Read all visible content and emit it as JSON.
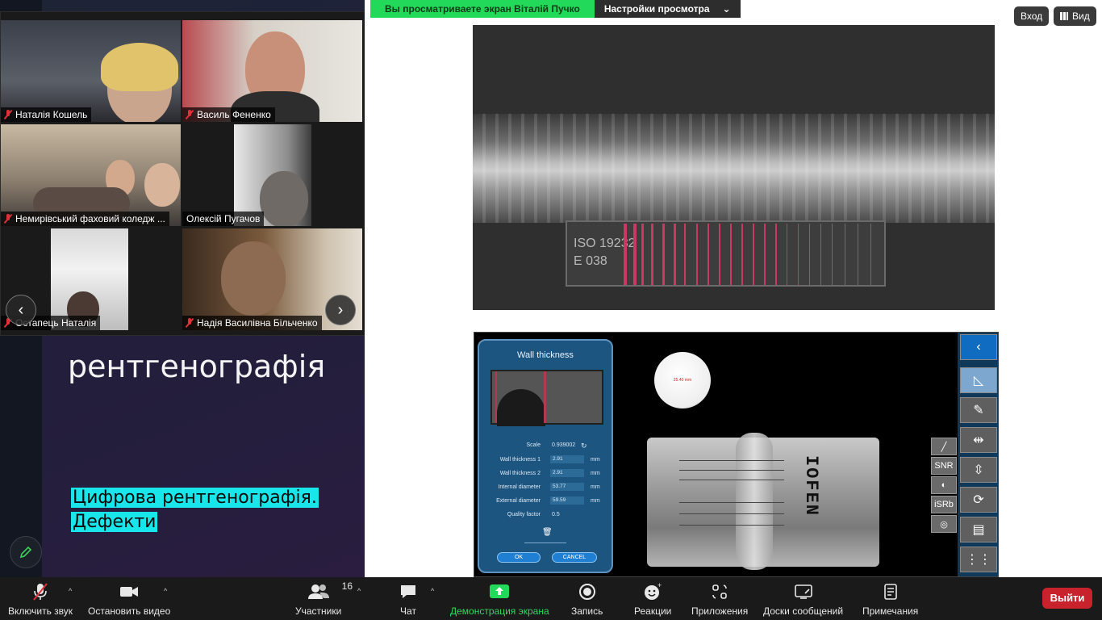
{
  "banner": {
    "sharing_text": "Вы просматриваете экран Віталій Пучко",
    "view_settings": "Настройки просмотра"
  },
  "top_buttons": {
    "enter": "Вход",
    "view": "Вид"
  },
  "participants": [
    {
      "name": "Наталія Кошель"
    },
    {
      "name": "Василь Фененко"
    },
    {
      "name": "Немирівський фаховий коледж ..."
    },
    {
      "name": "Олексій Пугачов"
    },
    {
      "name": "Остапець Наталія"
    },
    {
      "name": "Надія Василівна Більченко"
    }
  ],
  "slide": {
    "heading": "рентгенографія",
    "highlight_line1": "Цифрова рентгенографія.",
    "highlight_line2": "Дефекти"
  },
  "xray_top": {
    "iso_line1": "ISO 19232",
    "iso_line2": "E 038"
  },
  "wall_panel": {
    "title": "Wall thickness",
    "scale_label": "Scale",
    "scale_value": "0.939002",
    "rows": [
      {
        "label": "Wall thickness 1",
        "value": "2.91",
        "unit": "mm"
      },
      {
        "label": "Wall thickness 2",
        "value": "2.91",
        "unit": "mm"
      },
      {
        "label": "Internal diameter",
        "value": "53.77",
        "unit": "mm"
      },
      {
        "label": "External diameter",
        "value": "59.59",
        "unit": "mm"
      }
    ],
    "quality_label": "Quality factor",
    "quality_value": "0.5",
    "ok": "OK",
    "cancel": "CANCEL"
  },
  "measure": {
    "circle": "25.40 mm"
  },
  "pipe_stamp": "IOFEN",
  "tools": {
    "snr": "SNR",
    "isrb": "iSRb"
  },
  "controls": {
    "audio": "Включить звук",
    "video": "Остановить видео",
    "participants": "Участники",
    "participants_count": "16",
    "chat": "Чат",
    "share": "Демонстрация экрана",
    "record": "Запись",
    "reactions": "Реакции",
    "apps": "Приложения",
    "whiteboards": "Доски сообщений",
    "notes": "Примечания",
    "leave": "Выйти"
  },
  "colors": {
    "share_green": "#23d959",
    "leave_red": "#c8232c",
    "slide_highlight": "#18e6ea"
  }
}
